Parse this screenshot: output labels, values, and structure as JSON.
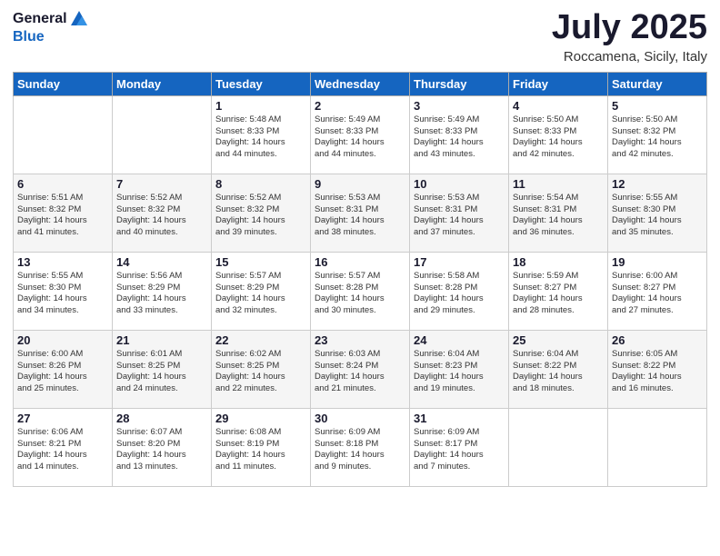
{
  "logo": {
    "general": "General",
    "blue": "Blue"
  },
  "title": "July 2025",
  "location": "Roccamena, Sicily, Italy",
  "weekdays": [
    "Sunday",
    "Monday",
    "Tuesday",
    "Wednesday",
    "Thursday",
    "Friday",
    "Saturday"
  ],
  "weeks": [
    [
      {
        "day": "",
        "detail": ""
      },
      {
        "day": "",
        "detail": ""
      },
      {
        "day": "1",
        "detail": "Sunrise: 5:48 AM\nSunset: 8:33 PM\nDaylight: 14 hours\nand 44 minutes."
      },
      {
        "day": "2",
        "detail": "Sunrise: 5:49 AM\nSunset: 8:33 PM\nDaylight: 14 hours\nand 44 minutes."
      },
      {
        "day": "3",
        "detail": "Sunrise: 5:49 AM\nSunset: 8:33 PM\nDaylight: 14 hours\nand 43 minutes."
      },
      {
        "day": "4",
        "detail": "Sunrise: 5:50 AM\nSunset: 8:33 PM\nDaylight: 14 hours\nand 42 minutes."
      },
      {
        "day": "5",
        "detail": "Sunrise: 5:50 AM\nSunset: 8:32 PM\nDaylight: 14 hours\nand 42 minutes."
      }
    ],
    [
      {
        "day": "6",
        "detail": "Sunrise: 5:51 AM\nSunset: 8:32 PM\nDaylight: 14 hours\nand 41 minutes."
      },
      {
        "day": "7",
        "detail": "Sunrise: 5:52 AM\nSunset: 8:32 PM\nDaylight: 14 hours\nand 40 minutes."
      },
      {
        "day": "8",
        "detail": "Sunrise: 5:52 AM\nSunset: 8:32 PM\nDaylight: 14 hours\nand 39 minutes."
      },
      {
        "day": "9",
        "detail": "Sunrise: 5:53 AM\nSunset: 8:31 PM\nDaylight: 14 hours\nand 38 minutes."
      },
      {
        "day": "10",
        "detail": "Sunrise: 5:53 AM\nSunset: 8:31 PM\nDaylight: 14 hours\nand 37 minutes."
      },
      {
        "day": "11",
        "detail": "Sunrise: 5:54 AM\nSunset: 8:31 PM\nDaylight: 14 hours\nand 36 minutes."
      },
      {
        "day": "12",
        "detail": "Sunrise: 5:55 AM\nSunset: 8:30 PM\nDaylight: 14 hours\nand 35 minutes."
      }
    ],
    [
      {
        "day": "13",
        "detail": "Sunrise: 5:55 AM\nSunset: 8:30 PM\nDaylight: 14 hours\nand 34 minutes."
      },
      {
        "day": "14",
        "detail": "Sunrise: 5:56 AM\nSunset: 8:29 PM\nDaylight: 14 hours\nand 33 minutes."
      },
      {
        "day": "15",
        "detail": "Sunrise: 5:57 AM\nSunset: 8:29 PM\nDaylight: 14 hours\nand 32 minutes."
      },
      {
        "day": "16",
        "detail": "Sunrise: 5:57 AM\nSunset: 8:28 PM\nDaylight: 14 hours\nand 30 minutes."
      },
      {
        "day": "17",
        "detail": "Sunrise: 5:58 AM\nSunset: 8:28 PM\nDaylight: 14 hours\nand 29 minutes."
      },
      {
        "day": "18",
        "detail": "Sunrise: 5:59 AM\nSunset: 8:27 PM\nDaylight: 14 hours\nand 28 minutes."
      },
      {
        "day": "19",
        "detail": "Sunrise: 6:00 AM\nSunset: 8:27 PM\nDaylight: 14 hours\nand 27 minutes."
      }
    ],
    [
      {
        "day": "20",
        "detail": "Sunrise: 6:00 AM\nSunset: 8:26 PM\nDaylight: 14 hours\nand 25 minutes."
      },
      {
        "day": "21",
        "detail": "Sunrise: 6:01 AM\nSunset: 8:25 PM\nDaylight: 14 hours\nand 24 minutes."
      },
      {
        "day": "22",
        "detail": "Sunrise: 6:02 AM\nSunset: 8:25 PM\nDaylight: 14 hours\nand 22 minutes."
      },
      {
        "day": "23",
        "detail": "Sunrise: 6:03 AM\nSunset: 8:24 PM\nDaylight: 14 hours\nand 21 minutes."
      },
      {
        "day": "24",
        "detail": "Sunrise: 6:04 AM\nSunset: 8:23 PM\nDaylight: 14 hours\nand 19 minutes."
      },
      {
        "day": "25",
        "detail": "Sunrise: 6:04 AM\nSunset: 8:22 PM\nDaylight: 14 hours\nand 18 minutes."
      },
      {
        "day": "26",
        "detail": "Sunrise: 6:05 AM\nSunset: 8:22 PM\nDaylight: 14 hours\nand 16 minutes."
      }
    ],
    [
      {
        "day": "27",
        "detail": "Sunrise: 6:06 AM\nSunset: 8:21 PM\nDaylight: 14 hours\nand 14 minutes."
      },
      {
        "day": "28",
        "detail": "Sunrise: 6:07 AM\nSunset: 8:20 PM\nDaylight: 14 hours\nand 13 minutes."
      },
      {
        "day": "29",
        "detail": "Sunrise: 6:08 AM\nSunset: 8:19 PM\nDaylight: 14 hours\nand 11 minutes."
      },
      {
        "day": "30",
        "detail": "Sunrise: 6:09 AM\nSunset: 8:18 PM\nDaylight: 14 hours\nand 9 minutes."
      },
      {
        "day": "31",
        "detail": "Sunrise: 6:09 AM\nSunset: 8:17 PM\nDaylight: 14 hours\nand 7 minutes."
      },
      {
        "day": "",
        "detail": ""
      },
      {
        "day": "",
        "detail": ""
      }
    ]
  ]
}
